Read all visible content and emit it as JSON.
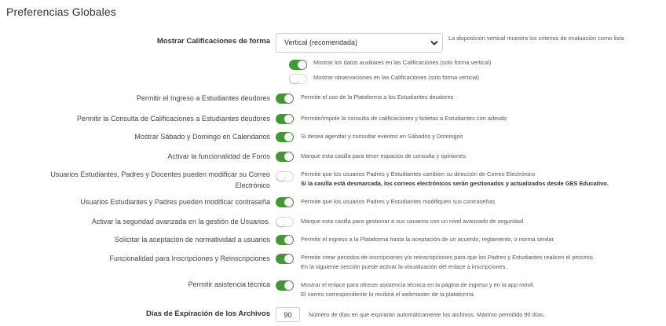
{
  "title": "Preferencias Globales",
  "form_mode": {
    "label": "Mostrar Calificaciones de forma",
    "selected": "Vertical (recomendada)",
    "description": "La disposición vertical muestra los criterios de evaluación como lista",
    "sub_options": [
      {
        "label": "Mostrar los datos auxiliares en las Calificaciones (solo forma vertical)",
        "on": true
      },
      {
        "label": "Mostrar observaciones en las Calificaciones (solo forma vertical)",
        "on": false
      }
    ]
  },
  "settings": [
    {
      "label": "Permitir el Ingreso a Estudiantes deudores",
      "on": true,
      "description": "Permite el uso de la Plataforma a los Estudiantes deudores"
    },
    {
      "label": "Permitir la Consulta de Calificaciones a Estudiantes deudores",
      "on": true,
      "description": "Permite/Impide la consulta de calificaciones y boletas a Estudiantes con adeudo"
    },
    {
      "label": "Mostrar Sábado y Domingo en Calendarios",
      "on": true,
      "description": "Si desea agendar y consultar eventos en Sábados y Domingos"
    },
    {
      "label": "Activar la funcionalidad de Foros",
      "on": true,
      "description": "Marque esta casilla para tener espacios de consulta y opiniones"
    },
    {
      "label_line1": "Usuarios Estudiantes, Padres y Docentes pueden modificar su Correo",
      "label_line2": "Electrónico",
      "on": false,
      "description": "Permite que los usuarios Padres y Estudiantes cambien su dirección de Correo Electrónico",
      "description_strong": "Si la casilla está desmarcada, los correos electrónicos serán gestionados y actualizados desde GES Educativo."
    },
    {
      "label": "Usuarios Estudiantes y Padres pueden modificar contraseña",
      "on": true,
      "description": "Permite que los usuarios Padres y Estudiantes modifiquen sus contraseñas"
    },
    {
      "label": "Activar la seguridad avanzada en la gestión de Usuarios.",
      "on": false,
      "description": "Marque esta casilla para gestionar a sus usuarios con un nivel avanzado de seguridad"
    },
    {
      "label": "Solicitar la aceptación de normatividad a usuarios",
      "on": true,
      "description": "Permitir el ingreso a la Plataforma hasta la aceptación de un acuerdo, reglamento, o norma similar."
    },
    {
      "label": "Funcionalidad para Inscripciones y Reinscripciones",
      "on": true,
      "description": "Permite crear periodos de inscripciones y/o reinscripciones para que los Padres y Estudiantes realicen el proceso.",
      "description2": "En la siguiente sección puede activar la visualización del enlace a inscripciones."
    },
    {
      "label": "Permitir asistencia técnica",
      "on": true,
      "description": "Mostrar el enlace para ofrecer asistencia técnica en la página de ingreso y en la app móvil.",
      "description2": "El correo correspondiente lo recibirá el webmaster de la plataforma."
    }
  ],
  "expiration": {
    "label": "Días de Expiración de los Archivos",
    "value": "90",
    "description": "Número de días en que expirarán automáticamente los archivos. Máximo permitido 90 días."
  },
  "colors": {
    "toggle_on": "#3f9a2f",
    "toggle_off_border": "#d6d6d6"
  }
}
